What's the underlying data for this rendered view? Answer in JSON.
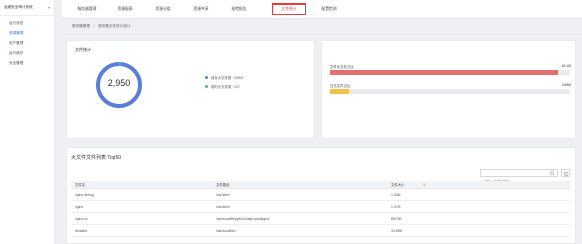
{
  "sidebar": {
    "title": "运维安全审计系统",
    "items": [
      {
        "label": "运行状态",
        "active": false
      },
      {
        "label": "资源管理",
        "active": true
      },
      {
        "label": "用户管理",
        "active": false
      },
      {
        "label": "运行维护",
        "active": false
      },
      {
        "label": "安全管理",
        "active": false
      }
    ]
  },
  "tabs": [
    {
      "label": "服务器管理",
      "active": false
    },
    {
      "label": "资源报表",
      "active": false
    },
    {
      "label": "资源分组",
      "active": false
    },
    {
      "label": "资源共享",
      "active": false
    },
    {
      "label": "巡检报告",
      "active": false
    },
    {
      "label": "文件统计",
      "active": true
    },
    {
      "label": "配置检测",
      "active": false
    }
  ],
  "breadcrumb": [
    "服务器管理",
    "服务器文件统计统计"
  ],
  "file_stats": {
    "title": "文件统计",
    "total": "2,950",
    "legend": [
      {
        "label": "保存大文件数（2903）",
        "color": "#5b7fd6"
      },
      {
        "label": "临时大文件数（47）",
        "color": "#3db0e0"
      }
    ]
  },
  "usage": {
    "items": [
      {
        "label": "文件大文件占比",
        "value": "45.1M",
        "fill": 0.95,
        "color": "#e46f6f"
      },
      {
        "label": "日志文件占比",
        "value": "3.69M",
        "fill": 0.08,
        "color": "#f2c14a"
      }
    ]
  },
  "table": {
    "title": "大文件文件列表 Top50",
    "search_placeholder": "请输入文件名搜索",
    "columns": [
      "文件名",
      "文件路径",
      "文件大小"
    ],
    "rows": [
      {
        "name": "nginx-debug",
        "path": "/usr/sbin/",
        "size": "1.33M"
      },
      {
        "name": "nginx",
        "path": "/usr/sbin/",
        "size": "1.37M"
      },
      {
        "name": "nginx.so",
        "path": "/usr/local/lib/python3/site-packages/",
        "size": "892.5K"
      },
      {
        "name": "dmsdbd",
        "path": "/usr/local/bin/",
        "size": "33.89M"
      }
    ]
  }
}
